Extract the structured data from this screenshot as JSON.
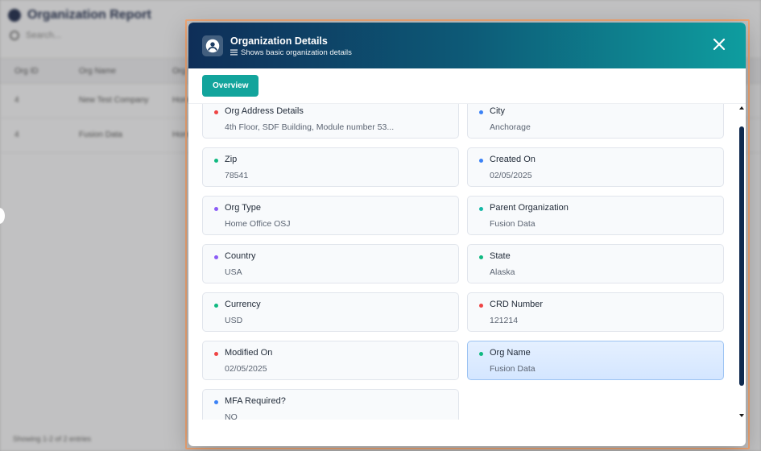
{
  "background": {
    "title": "Organization Report",
    "search_placeholder": "Search...",
    "columns": [
      "Org ID",
      "Org Name",
      "Org Type"
    ],
    "rows": [
      [
        "4",
        "New Test Company",
        "Hom"
      ],
      [
        "4",
        "Fusion Data",
        "Hom"
      ]
    ],
    "footer": "Showing 1-2 of 2 entries"
  },
  "modal": {
    "title": "Organization Details",
    "subtitle": "Shows basic organization details",
    "tabs": [
      {
        "label": "Overview",
        "active": true
      }
    ],
    "fields": [
      {
        "label": "Org Address Details",
        "value": "4th Floor, SDF Building, Module number 53...",
        "dot": "#ef4444"
      },
      {
        "label": "City",
        "value": "Anchorage",
        "dot": "#3b82f6"
      },
      {
        "label": "Zip",
        "value": "78541",
        "dot": "#10b981"
      },
      {
        "label": "Created On",
        "value": "02/05/2025",
        "dot": "#3b82f6"
      },
      {
        "label": "Org Type",
        "value": "Home Office OSJ",
        "dot": "#8b5cf6"
      },
      {
        "label": "Parent Organization",
        "value": "Fusion Data",
        "dot": "#14b8a6"
      },
      {
        "label": "Country",
        "value": "USA",
        "dot": "#8b5cf6"
      },
      {
        "label": "State",
        "value": "Alaska",
        "dot": "#10b981"
      },
      {
        "label": "Currency",
        "value": "USD",
        "dot": "#10b981"
      },
      {
        "label": "CRD Number",
        "value": "121214",
        "dot": "#ef4444"
      },
      {
        "label": "Modified On",
        "value": "02/05/2025",
        "dot": "#ef4444"
      },
      {
        "label": "Org Name",
        "value": "Fusion Data",
        "dot": "#10b981",
        "selected": true
      },
      {
        "label": "MFA Required?",
        "value": "NO",
        "dot": "#3b82f6"
      }
    ]
  },
  "colors": {
    "header_start": "#0e2e58",
    "header_end": "#0e9d9f",
    "tab_active": "#12a49c",
    "focus_outline": "#f0a674"
  }
}
